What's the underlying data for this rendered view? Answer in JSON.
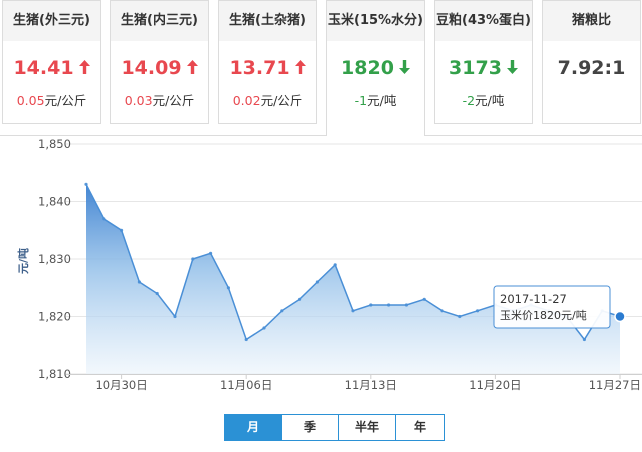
{
  "cards": [
    {
      "title": "生猪(外三元)",
      "price": "14.41",
      "trend": "up",
      "change": "0.05",
      "unit": "元/公斤"
    },
    {
      "title": "生猪(内三元)",
      "price": "14.09",
      "trend": "up",
      "change": "0.03",
      "unit": "元/公斤"
    },
    {
      "title": "生猪(土杂猪)",
      "price": "13.71",
      "trend": "up",
      "change": "0.02",
      "unit": "元/公斤"
    },
    {
      "title": "玉米(15%水分)",
      "price": "1820",
      "trend": "down",
      "change": "-1",
      "unit": "元/吨"
    },
    {
      "title": "豆粕(43%蛋白)",
      "price": "3173",
      "trend": "down",
      "change": "-2",
      "unit": "元/吨"
    },
    {
      "title": "猪粮比",
      "price": "7.92:1",
      "trend": "flat",
      "change": "",
      "unit": ""
    }
  ],
  "active_card": 3,
  "colors": {
    "up": "#e8484f",
    "down": "#33a04a",
    "accent": "#2b91d5",
    "line": "#4a8fd6"
  },
  "tabs": [
    "月",
    "季",
    "半年",
    "年"
  ],
  "active_tab": 0,
  "tooltip": {
    "date": "2017-11-27",
    "label": "玉米价1820元/吨"
  },
  "chart_data": {
    "type": "area",
    "title": "",
    "ylabel": "元/吨",
    "xlabel": "",
    "ylim": [
      1810,
      1850
    ],
    "yticks": [
      "1,850",
      "1,840",
      "1,830",
      "1,820",
      "1,810"
    ],
    "grid": true,
    "x": [
      "2017-10-28",
      "2017-10-29",
      "2017-10-30",
      "2017-10-31",
      "2017-11-01",
      "2017-11-02",
      "2017-11-03",
      "2017-11-04",
      "2017-11-05",
      "2017-11-06",
      "2017-11-07",
      "2017-11-08",
      "2017-11-09",
      "2017-11-10",
      "2017-11-11",
      "2017-11-12",
      "2017-11-13",
      "2017-11-14",
      "2017-11-15",
      "2017-11-16",
      "2017-11-17",
      "2017-11-18",
      "2017-11-19",
      "2017-11-20",
      "2017-11-21",
      "2017-11-22",
      "2017-11-23",
      "2017-11-24",
      "2017-11-25",
      "2017-11-26",
      "2017-11-27"
    ],
    "values": [
      1843,
      1837,
      1835,
      1826,
      1824,
      1820,
      1830,
      1831,
      1825,
      1816,
      1818,
      1821,
      1823,
      1826,
      1829,
      1821,
      1822,
      1822,
      1822,
      1823,
      1821,
      1820,
      1821,
      1822,
      1821,
      1822,
      1821,
      1820,
      1816,
      1821,
      1820
    ],
    "xtick_labels": [
      {
        "x": "2017-10-30",
        "label": "10月30日"
      },
      {
        "x": "2017-11-06",
        "label": "11月06日"
      },
      {
        "x": "2017-11-13",
        "label": "11月13日"
      },
      {
        "x": "2017-11-20",
        "label": "11月20日"
      },
      {
        "x": "2017-11-27",
        "label": "11月27日"
      }
    ],
    "highlight": "2017-11-27"
  }
}
